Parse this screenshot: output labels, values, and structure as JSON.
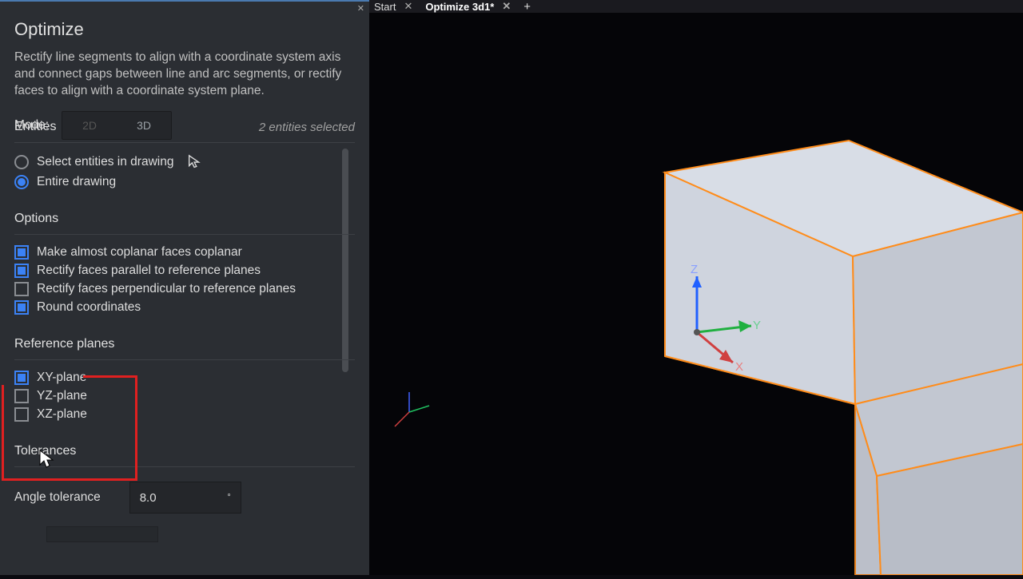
{
  "tabs": [
    {
      "label": "Start",
      "active": false
    },
    {
      "label": "Optimize 3d1*",
      "active": true
    }
  ],
  "panel": {
    "title": "Optimize",
    "description": "Rectify line segments to align with a coordinate system axis and connect gaps between line and arc segments, or rectify faces to align with a coordinate system plane.",
    "mode_label": "Mode:",
    "mode_2d": "2D",
    "mode_3d": "3D",
    "entities": {
      "title": "Entities",
      "status": "2 entities selected",
      "select_in_drawing": "Select entities in drawing",
      "entire_drawing": "Entire drawing"
    },
    "options": {
      "title": "Options",
      "coplanar": "Make almost coplanar faces coplanar",
      "parallel": "Rectify faces parallel to reference planes",
      "perpendicular": "Rectify faces perpendicular to reference planes",
      "round": "Round coordinates"
    },
    "reference_planes": {
      "title": "Reference planes",
      "xy": "XY-plane",
      "yz": "YZ-plane",
      "xz": "XZ-plane"
    },
    "tolerances": {
      "title": "Tolerances",
      "angle_label": "Angle tolerance",
      "angle_value": "8.0"
    }
  },
  "axes": {
    "x": "X",
    "y": "Y",
    "z": "Z"
  }
}
